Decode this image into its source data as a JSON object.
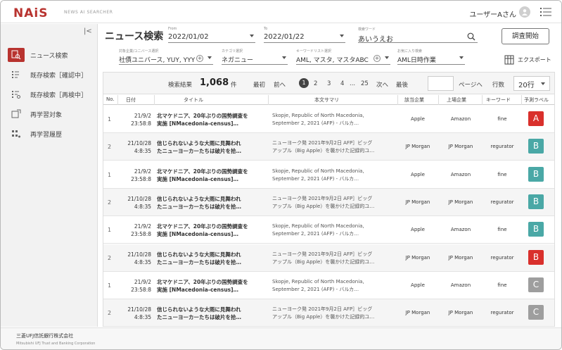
{
  "header": {
    "logo": "NAiS",
    "logo_sub": "NEWS AI SEARCHER",
    "user_name": "ユーザーAさん"
  },
  "sidebar": {
    "items": [
      {
        "label": "ニュース検索",
        "icon": "search-doc-icon",
        "active": true
      },
      {
        "label": "既存検索［確認中］",
        "icon": "list-icon",
        "active": false
      },
      {
        "label": "既存検索［再検中］",
        "icon": "list-recheck-icon",
        "active": false
      },
      {
        "label": "再学習対象",
        "icon": "relearn-icon",
        "active": false
      },
      {
        "label": "再学習履歴",
        "icon": "history-icon",
        "active": false
      }
    ],
    "company": "三菱UFJ信託銀行株式会社",
    "company_en": "Mitsubishi UFJ Trust and Banking Corporation"
  },
  "search": {
    "title": "ニュース検索",
    "from_label": "From",
    "from_value": "2022/01/02",
    "to_label": "To",
    "to_value": "2022/01/22",
    "keyword_label": "検索ワード",
    "keyword_value": "あいうえお",
    "company_label": "対象企業/ユニバース選択",
    "company_value": "社債ユニバース, YUY, YYY",
    "category_label": "カテゴリ選択",
    "category_value": "ネガニュー",
    "word_label": "キーワードリスト選択",
    "word_value": "AML, マスタ, マスタABC",
    "job_label": "お気に入り検索",
    "job_value": "AML日時作業",
    "submit": "調査開始",
    "export": "エクスポート"
  },
  "results": {
    "label": "検索結果",
    "count": "1,068",
    "unit": "件",
    "first": "最初",
    "prev": "前へ",
    "pages": [
      "1",
      "2",
      "3",
      "4",
      "...",
      "25"
    ],
    "next": "次へ",
    "last": "最後",
    "go": "ページへ",
    "rows_label": "行数",
    "rows_value": "20行"
  },
  "table": {
    "headers": [
      "No.",
      "日付",
      "タイトル",
      "本文サマリ",
      "該当企業",
      "上場企業",
      "キーワード",
      "予測ラベル"
    ],
    "rows": [
      {
        "no": "1",
        "date1": "21/9/2",
        "date2": "23:58:8",
        "title1": "北マケドニア、20年ぶりの国勢調査を",
        "title2": "実施 [NMacedonia-census]…",
        "body1": "Skopje, Republic of North Macedonia,",
        "body2": "September 2, 2021 (AFP) - バルカ…",
        "c1": "Apple",
        "c2": "Amazon",
        "c3": "fine",
        "label": "A",
        "color": "#d9302c"
      },
      {
        "no": "2",
        "date1": "21/10/28",
        "date2": "4:8:35",
        "title1": "信じられないような大雨に見舞われ",
        "title2": "たニューヨーカーたちは破片を拾…",
        "body1": "ニューヨーク発 2021年9月2日 AFP］ビッグ",
        "body2": "アップル（Big Apple）を襲かけた記録的ユ…",
        "c1": "JP Morgan",
        "c2": "JP Morgan",
        "c3": "regurator",
        "label": "B",
        "color": "#4aa8a6"
      },
      {
        "no": "1",
        "date1": "21/9/2",
        "date2": "23:58:8",
        "title1": "北マケドニア、20年ぶりの国勢調査を",
        "title2": "実施 [NMacedonia-census]…",
        "body1": "Skopje, Republic of North Macedonia,",
        "body2": "September 2, 2021 (AFP) - バルカ…",
        "c1": "Apple",
        "c2": "Amazon",
        "c3": "fine",
        "label": "B",
        "color": "#4aa8a6"
      },
      {
        "no": "2",
        "date1": "21/10/28",
        "date2": "4:8:35",
        "title1": "信じられないような大雨に見舞われ",
        "title2": "たニューヨーカーたちは破片を拾…",
        "body1": "ニューヨーク発 2021年9月2日 AFP］ビッグ",
        "body2": "アップル（Big Apple）を襲かけた記録的ユ…",
        "c1": "JP Morgan",
        "c2": "JP Morgan",
        "c3": "regurator",
        "label": "B",
        "color": "#4aa8a6"
      },
      {
        "no": "1",
        "date1": "21/9/2",
        "date2": "23:58:8",
        "title1": "北マケドニア、20年ぶりの国勢調査を",
        "title2": "実施 [NMacedonia-census]…",
        "body1": "Skopje, Republic of North Macedonia,",
        "body2": "September 2, 2021 (AFP) - バルカ…",
        "c1": "Apple",
        "c2": "Amazon",
        "c3": "fine",
        "label": "B",
        "color": "#4aa8a6"
      },
      {
        "no": "2",
        "date1": "21/10/28",
        "date2": "4:8:35",
        "title1": "信じられないような大雨に見舞われ",
        "title2": "たニューヨーカーたちは破片を拾…",
        "body1": "ニューヨーク発 2021年9月2日 AFP］ビッグ",
        "body2": "アップル（Big Apple）を襲かけた記録的ユ…",
        "c1": "JP Morgan",
        "c2": "JP Morgan",
        "c3": "regurator",
        "label": "B",
        "color": "#d9302c"
      },
      {
        "no": "1",
        "date1": "21/9/2",
        "date2": "23:58:8",
        "title1": "北マケドニア、20年ぶりの国勢調査を",
        "title2": "実施 [NMacedonia-census]…",
        "body1": "Skopje, Republic of North Macedonia,",
        "body2": "September 2, 2021 (AFP) - バルカ…",
        "c1": "Apple",
        "c2": "Amazon",
        "c3": "fine",
        "label": "C",
        "color": "#9e9e9e"
      },
      {
        "no": "2",
        "date1": "21/10/28",
        "date2": "4:8:35",
        "title1": "信じられないような大雨に見舞われ",
        "title2": "たニューヨーカーたちは破片を拾…",
        "body1": "ニューヨーク発 2021年9月2日 AFP］ビッグ",
        "body2": "アップル（Big Apple）を襲かけた記録的ユ…",
        "c1": "JP Morgan",
        "c2": "JP Morgan",
        "c3": "regurator",
        "label": "C",
        "color": "#9e9e9e"
      }
    ]
  }
}
